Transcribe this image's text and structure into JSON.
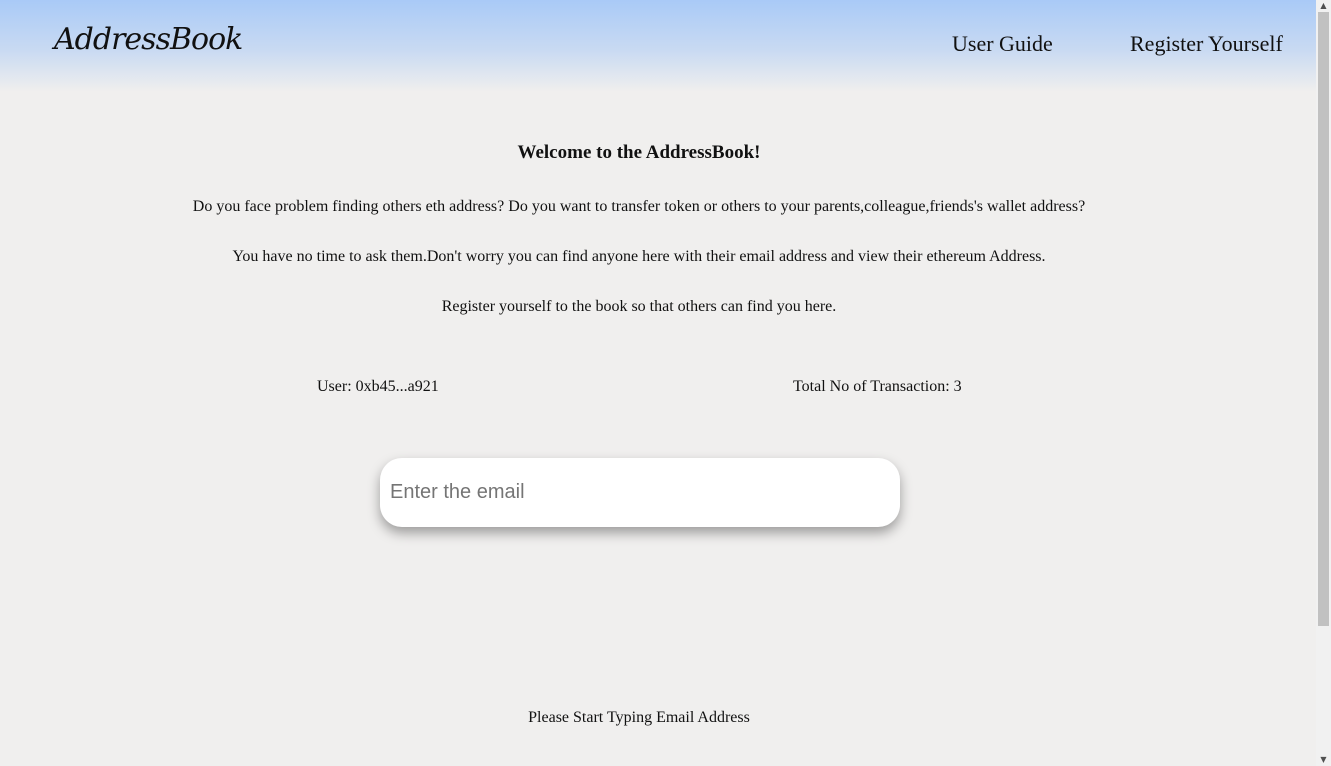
{
  "header": {
    "logo": "AddressBook",
    "nav": {
      "user_guide": "User Guide",
      "register": "Register Yourself"
    }
  },
  "main": {
    "welcome": "Welcome to the AddressBook!",
    "paragraphs": [
      "Do you face problem finding others eth address? Do you want to transfer token or others to your parents,colleague,friends's wallet address?",
      "You have no time to ask them.Don't worry you can find anyone here with their email address and view their ethereum Address.",
      "Register yourself to the book so that others can find you here."
    ],
    "user": "User: 0xb45...a921",
    "transactions": "Total No of Transaction: 3",
    "search": {
      "placeholder": "Enter the email",
      "value": ""
    },
    "status": "Please Start Typing Email Address"
  },
  "colors": {
    "header_top": "#a9caf7",
    "background": "#f0efee"
  }
}
